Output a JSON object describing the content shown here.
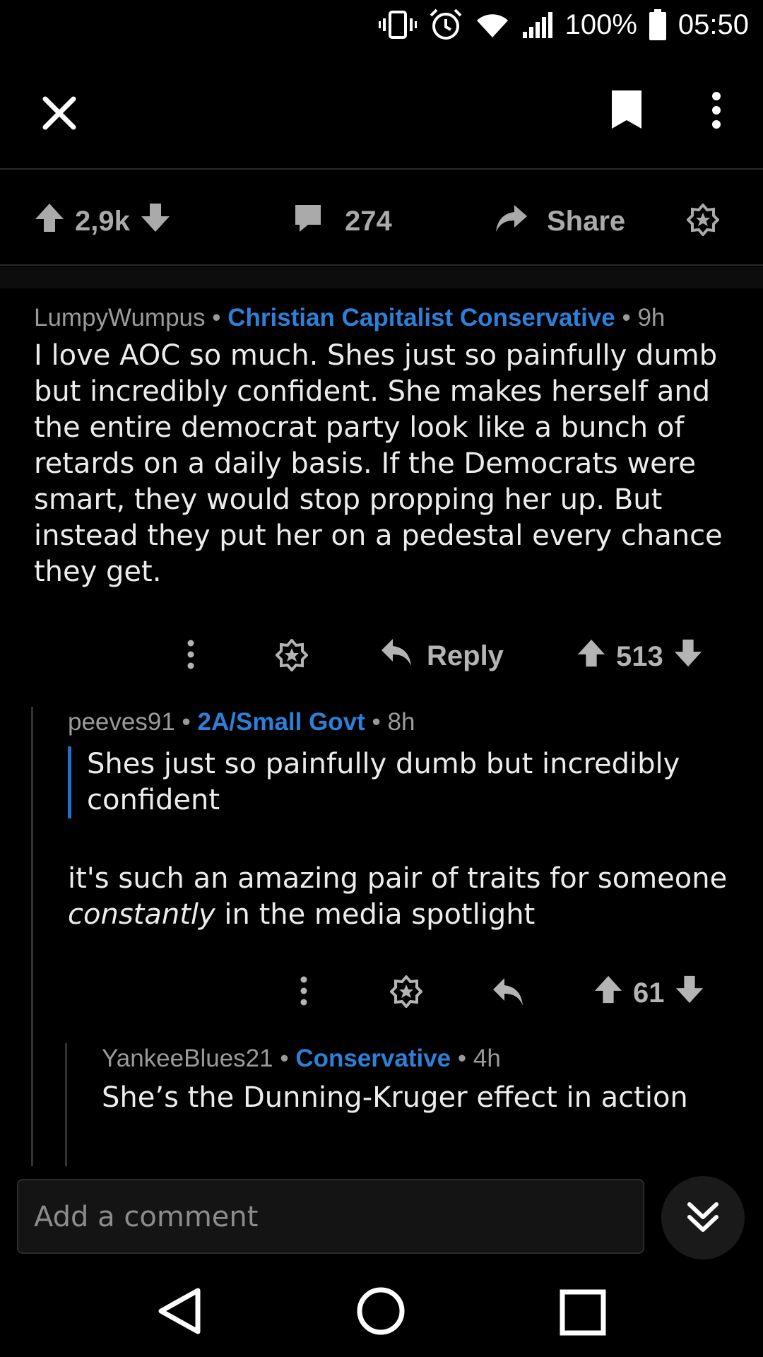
{
  "status_bar": {
    "battery": "100%",
    "time": "05:50"
  },
  "toolbar": {
    "icons": [
      "close-icon",
      "bookmark-icon",
      "more-vertical-icon"
    ]
  },
  "post_actions": {
    "score": "2,9k",
    "comments": "274",
    "share_label": "Share"
  },
  "comments": [
    {
      "author": "LumpyWumpus",
      "flair": "Christian Capitalist Conservative",
      "age": "9h",
      "body_lines": [
        "I love AOC so much. Shes just so painfully dumb",
        "but incredibly confident. She makes herself and",
        "the entire democrat party look like a bunch of",
        "retards on a daily basis. If the Democrats were",
        "smart, they would stop propping her up. But",
        "instead they put her on a pedestal every chance",
        "they get."
      ],
      "reply_label": "Reply",
      "score": "513"
    },
    {
      "author": "peeves91",
      "flair": "2A/Small Govt",
      "age": "8h",
      "quote_lines": [
        "Shes just so painfully dumb but incredibly",
        "confident"
      ],
      "body_line1": "it's such an amazing pair of traits for someone",
      "body_em": "constantly",
      "body_line2_rest": " in the media spotlight",
      "score": "61"
    },
    {
      "author": "YankeeBlues21",
      "flair": "Conservative",
      "age": "4h",
      "body": "She’s the Dunning-Kruger effect in action"
    }
  ],
  "compose": {
    "placeholder": "Add a comment"
  },
  "colors": {
    "background": "#000000",
    "flair": "#2d7fd8",
    "quote_bar": "#1f6fd0",
    "icon": "#b4b4b4"
  }
}
